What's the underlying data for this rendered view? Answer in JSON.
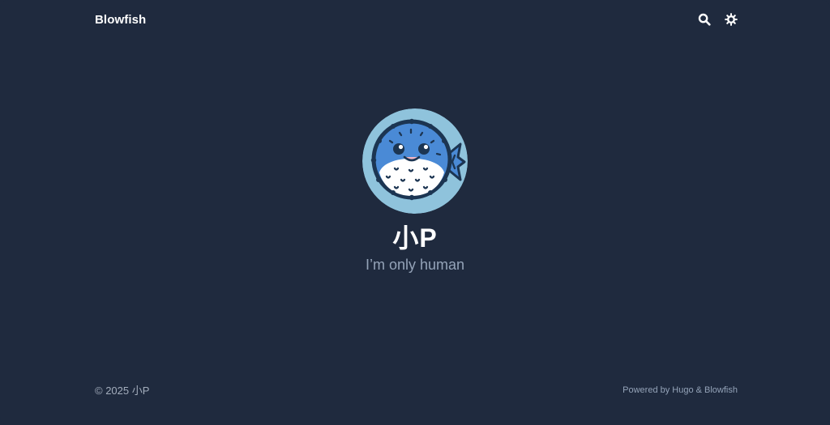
{
  "header": {
    "site_title": "Blowfish",
    "search_icon": "search-icon",
    "theme_icon": "sun-icon"
  },
  "profile": {
    "name": "小P",
    "headline": "I’m only human",
    "avatar_icon": "blowfish-avatar"
  },
  "footer": {
    "copyright": "© 2025 小P",
    "powered_by": "Powered by Hugo & Blowfish"
  },
  "colors": {
    "background": "#1f2a3e",
    "avatar_bg": "#8fc3dc",
    "fish_body": "#4a8ad6",
    "text_primary": "#ffffff",
    "text_muted": "#94a3b8"
  }
}
